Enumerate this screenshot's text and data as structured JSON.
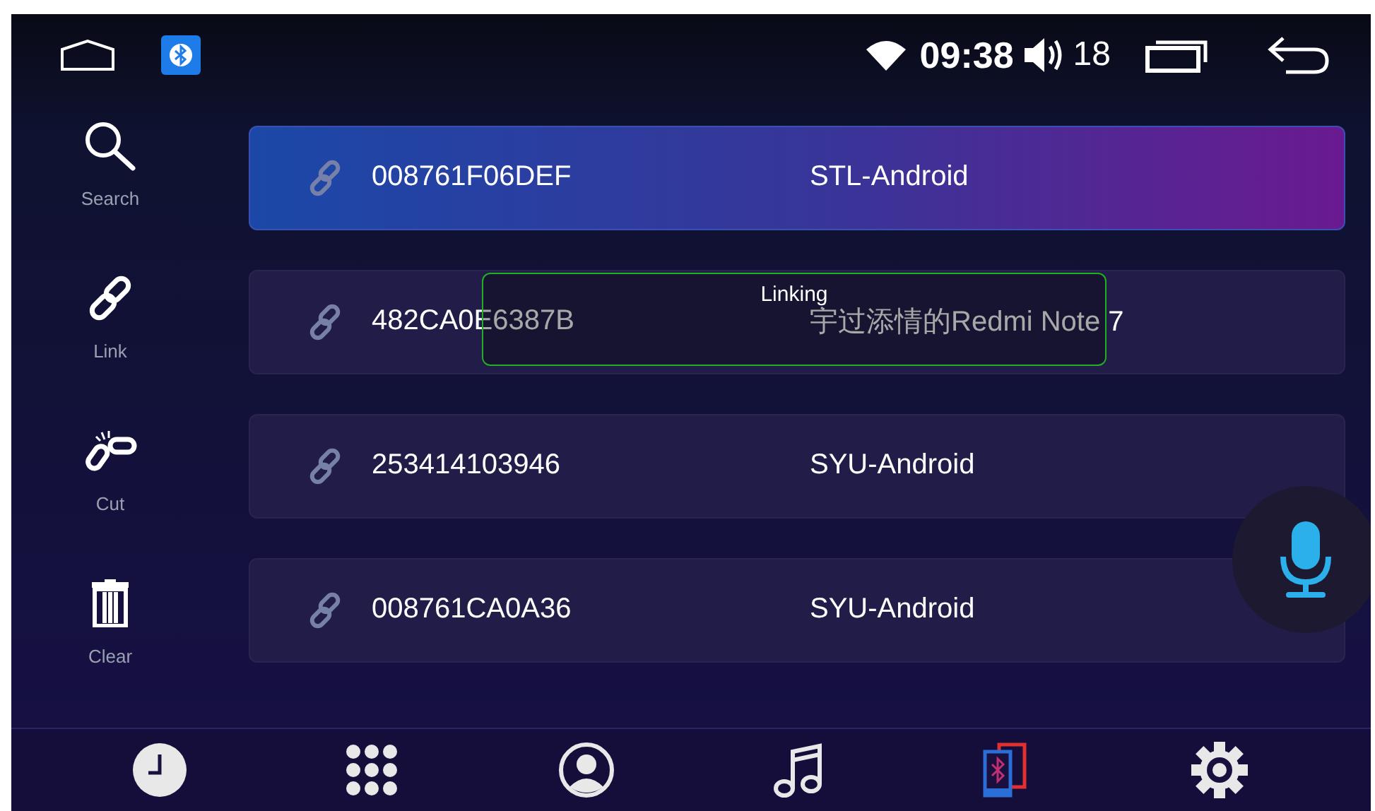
{
  "status_bar": {
    "time": "09:38",
    "volume": "18"
  },
  "sidebar": {
    "items": [
      {
        "kind": "search",
        "label": "Search"
      },
      {
        "kind": "link",
        "label": "Link"
      },
      {
        "kind": "cut",
        "label": "Cut"
      },
      {
        "kind": "clear",
        "label": "Clear"
      }
    ]
  },
  "devices": [
    {
      "address": "008761F06DEF",
      "name": "STL-Android",
      "selected": true
    },
    {
      "address": "482CA0E6387B",
      "name": "宇过添情的Redmi Note 7",
      "selected": false
    },
    {
      "address": "253414103946",
      "name": "SYU-Android",
      "selected": false
    },
    {
      "address": "008761CA0A36",
      "name": "SYU-Android",
      "selected": false
    }
  ],
  "toast": {
    "text": "Linking"
  },
  "bottom_nav": [
    {
      "kind": "clock",
      "selected": false
    },
    {
      "kind": "apps",
      "selected": false
    },
    {
      "kind": "contacts",
      "selected": false
    },
    {
      "kind": "music",
      "selected": false
    },
    {
      "kind": "bluetooth",
      "selected": true
    },
    {
      "kind": "settings",
      "selected": false
    }
  ]
}
